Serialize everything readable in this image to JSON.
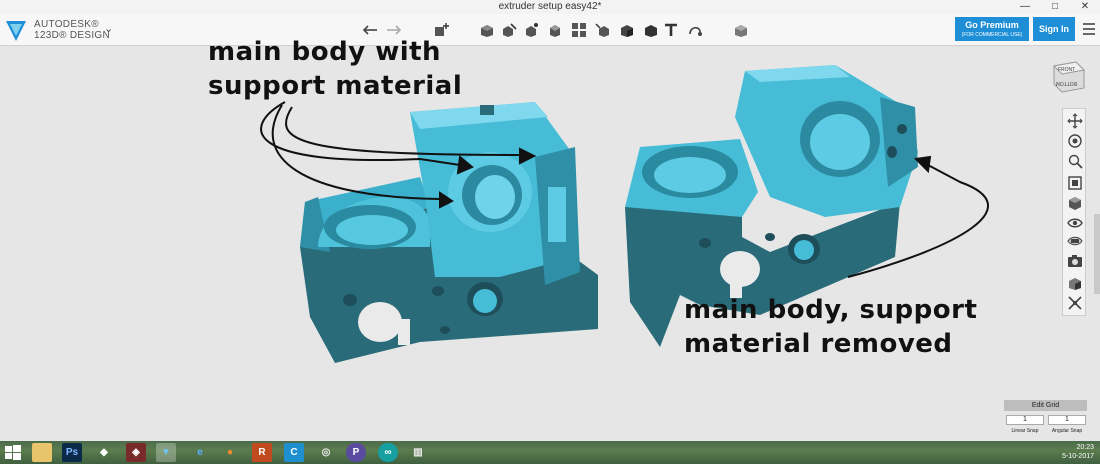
{
  "window": {
    "title": "extruder setup easy42*",
    "controls": [
      "—",
      "□",
      "✕"
    ]
  },
  "brand": {
    "line1": "AUTODESK®",
    "line2": "123D® DESIGN",
    "accent": "#1e8fd6",
    "model_color": "#3bb0cc"
  },
  "toolbar": {
    "tools": [
      "undo-icon",
      "redo-icon",
      "primitives-icon",
      "sketch-icon",
      "construct-icon",
      "modify-icon",
      "pattern-icon",
      "grouping-icon",
      "combine-icon",
      "measure-icon",
      "text-icon",
      "snap-icon",
      "material-icon"
    ],
    "premium": {
      "label": "Go Premium",
      "sub": "(FOR COMMERCIAL USE)"
    },
    "signin_label": "Sign In"
  },
  "viewcube": {
    "front": "FRONT",
    "bottom": "BOTTOM"
  },
  "annotations": {
    "left": [
      "main body with",
      "support material"
    ],
    "right": [
      "main body, support",
      "material removed"
    ]
  },
  "navbar": {
    "tools": [
      "pan-icon",
      "orbit-icon",
      "zoom-icon",
      "fit-icon",
      "view-icon",
      "visibility-icon",
      "materials-outline-icon",
      "camera-icon",
      "render-icon",
      "snap-to-icon"
    ]
  },
  "grid": {
    "title": "Edit Grid",
    "linear_value": "1",
    "angular_value": "1",
    "linear_label": "Linear Snap",
    "angular_label": "Angular Snap"
  },
  "taskbar": {
    "apps": [
      "folder-icon",
      "photoshop-icon",
      "inkscape-icon",
      "app-icon",
      "123d-icon",
      "ie-icon",
      "firefox-icon",
      "rhino-icon",
      "cura-icon",
      "chrome-icon",
      "p-icon",
      "arduino-icon",
      "explorer-icon"
    ],
    "time": "20:23",
    "date": "5-10-2017"
  }
}
